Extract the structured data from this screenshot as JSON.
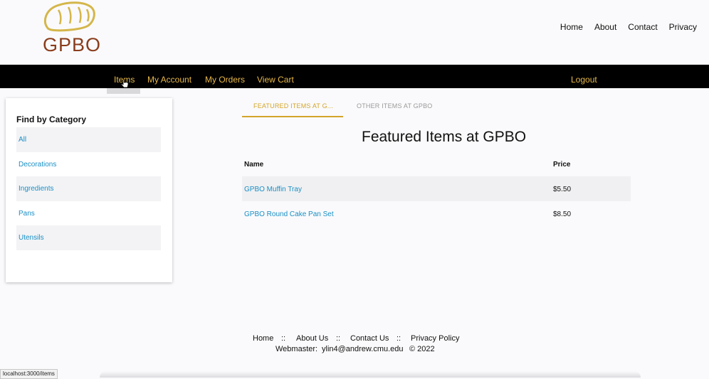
{
  "brand": {
    "logo_text": "GPBO"
  },
  "top_links": [
    "Home",
    "About",
    "Contact",
    "Privacy"
  ],
  "navbar": {
    "items": [
      "Items",
      "My Account",
      "My Orders",
      "View Cart"
    ],
    "logout": "Logout",
    "accent": "#e8b84a"
  },
  "sidebar": {
    "title": "Find by Category",
    "categories": [
      "All",
      "Decorations",
      "Ingredients",
      "Pans",
      "Utensils"
    ]
  },
  "tabs": {
    "active": "FEATURED ITEMS AT G...",
    "inactive": "OTHER ITEMS AT GPBO"
  },
  "main": {
    "title": "Featured Items at GPBO",
    "columns": [
      "Name",
      "Price"
    ],
    "rows": [
      {
        "name": "GPBO Muffin Tray",
        "price": "$5.50"
      },
      {
        "name": "GPBO Round Cake Pan Set",
        "price": "$8.50"
      }
    ]
  },
  "footer": {
    "links": [
      "Home",
      "::",
      "About Us",
      "::",
      "Contact Us",
      "::",
      "Privacy Policy"
    ],
    "webmaster_label": "Webmaster:",
    "webmaster_email": "ylin4@andrew.cmu.edu",
    "copyright": "© 2022"
  },
  "status_bar": {
    "url": "localhost:3000/items"
  }
}
